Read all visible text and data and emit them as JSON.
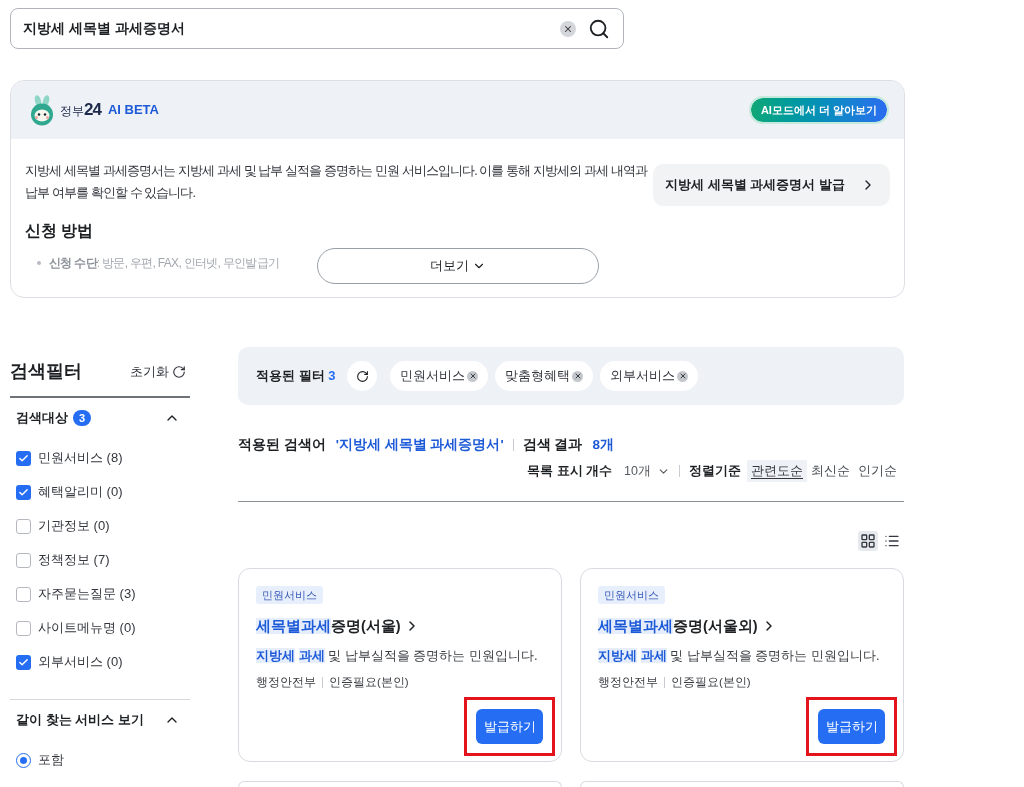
{
  "search": {
    "value": "지방세 세목별 과세증명서"
  },
  "ai_summary": {
    "brand_name": "정부",
    "brand_number": "24",
    "badge": "AI BETA",
    "ai_mode_button": "AI모드에서 더 알아보기",
    "description": "지방세 세목별 과세증명서는 지방세 과세 및 납부 실적을 증명하는 민원 서비스입니다. 이를 통해 지방세의 과세 내역과 납부 여부를 확인할 수 있습니다.",
    "link": "지방세 세목별 과세증명서 발급",
    "section_title": "신청 방법",
    "bullets": [
      "**신청 수단**: 방문, 우편, FAX, 인터넷, 무인발급기"
    ],
    "more_button": "더보기"
  },
  "filter_panel": {
    "title": "검색필터",
    "reset": "초기화",
    "groups": [
      {
        "kind": "checkbox",
        "title": "검색대상",
        "badge": "3",
        "expanded": true,
        "options": [
          {
            "label": "민원서비스 (8)",
            "checked": true
          },
          {
            "label": "혜택알리미 (0)",
            "checked": true
          },
          {
            "label": "기관정보 (0)",
            "checked": false
          },
          {
            "label": "정책정보 (7)",
            "checked": false
          },
          {
            "label": "자주묻는질문 (3)",
            "checked": false
          },
          {
            "label": "사이트메뉴명 (0)",
            "checked": false
          },
          {
            "label": "외부서비스 (0)",
            "checked": true
          }
        ]
      },
      {
        "kind": "radio",
        "title": "같이 찾는 서비스 보기",
        "expanded": true,
        "options": [
          {
            "label": "포함",
            "selected": true
          }
        ]
      }
    ]
  },
  "applied_filters": {
    "label": "적용된 필터",
    "count": "3",
    "chips": [
      "민원서비스",
      "맞춤형혜택",
      "외부서비스"
    ]
  },
  "result_summary": {
    "query_label": "적용된 검색어",
    "query": "'지방세 세목별 과세증명서'",
    "result_label": "검색 결과",
    "result_count": "8개"
  },
  "list_controls": {
    "page_size_label": "목록 표시 개수",
    "page_size": "10개",
    "sort_label": "정렬기준",
    "sort_options": [
      {
        "label": "관련도순",
        "selected": true
      },
      {
        "label": "최신순",
        "selected": false
      },
      {
        "label": "인기순",
        "selected": false
      }
    ]
  },
  "view_modes": [
    {
      "kind": "grid",
      "selected": true
    },
    {
      "kind": "list",
      "selected": false
    }
  ],
  "cards": [
    {
      "kind": "full",
      "tag": "민원서비스",
      "title": [
        {
          "text": "세목별과세",
          "match": true
        },
        {
          "text": "증명(서울)",
          "match": false
        }
      ],
      "description": [
        {
          "text": "지방세",
          "match": true
        },
        {
          "text": "과세",
          "match": true
        },
        {
          "text": "및 납부실적을 증명하는 민원입니다.",
          "match": false
        }
      ],
      "meta": [
        "행정안전부",
        "인증필요(본인)"
      ],
      "button": "발급하기",
      "highlighted": true
    },
    {
      "kind": "full",
      "tag": "민원서비스",
      "title": [
        {
          "text": "세목별과세",
          "match": true
        },
        {
          "text": "증명(서울외)",
          "match": false
        }
      ],
      "description": [
        {
          "text": "지방세",
          "match": true
        },
        {
          "text": "과세",
          "match": true
        },
        {
          "text": "및 납부실적을 증명하는 민원입니다.",
          "match": false
        }
      ],
      "meta": [
        "행정안전부",
        "인증필요(본인)"
      ],
      "button": "발급하기",
      "highlighted": true
    },
    {
      "kind": "cut-off"
    },
    {
      "kind": "cut-off"
    }
  ]
}
